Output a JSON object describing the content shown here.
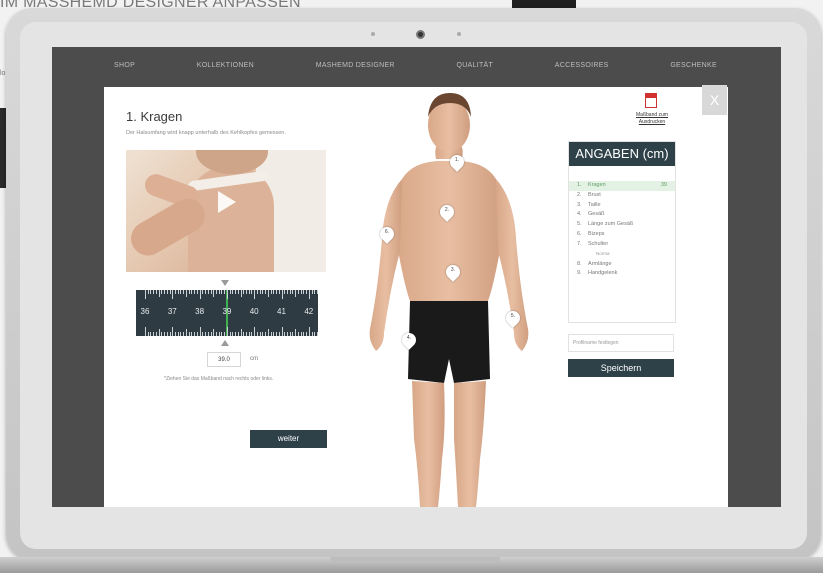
{
  "background": {
    "heading": "IM MASSHEMD DESIGNER ANPASSEN",
    "side_text": "lo"
  },
  "nav": {
    "items": [
      "SHOP",
      "KOLLEKTIONEN",
      "MASHEMD DESIGNER",
      "QUALITÄT",
      "ACCESSOIRES",
      "GESCHENKE"
    ]
  },
  "modal": {
    "close_label": "X",
    "step_title": "1. Kragen",
    "step_description": "Der Halsumfang wird knapp unterhalb des Kehlkopfes gemessen.",
    "ruler": {
      "labels": [
        "36",
        "37",
        "38",
        "39",
        "40",
        "41",
        "42"
      ],
      "selected": 39
    },
    "value_input": "39.0",
    "unit": "cm",
    "hint": "*Ziehen Sie das Maßband nach rechts oder links.",
    "next_label": "weiter",
    "pdf_label": "Maßband zum Ausdrucken",
    "pins": [
      "1.",
      "2.",
      "3.",
      "4.",
      "5.",
      "6."
    ],
    "panel": {
      "title": "ANGABEN (cm)",
      "items": [
        {
          "num": "1.",
          "label": "Kragen",
          "value": "39",
          "active": true
        },
        {
          "num": "2.",
          "label": "Brust",
          "value": ""
        },
        {
          "num": "3.",
          "label": "Taille",
          "value": ""
        },
        {
          "num": "4.",
          "label": "Gesäß",
          "value": ""
        },
        {
          "num": "5.",
          "label": "Länge zum Gesäß",
          "value": ""
        },
        {
          "num": "6.",
          "label": "Bizeps",
          "value": ""
        },
        {
          "num": "7.",
          "label": "Schulter",
          "value": "",
          "sub": "Norma"
        },
        {
          "num": "8.",
          "label": "Armlänge",
          "value": ""
        },
        {
          "num": "9.",
          "label": "Handgelenk",
          "value": ""
        }
      ],
      "profile_placeholder": "Profilname festlegen",
      "save_label": "Speichern"
    }
  },
  "colors": {
    "accent": "#2e4149",
    "active_green": "#3fb34f",
    "ruler_bg": "#2e3b42"
  }
}
